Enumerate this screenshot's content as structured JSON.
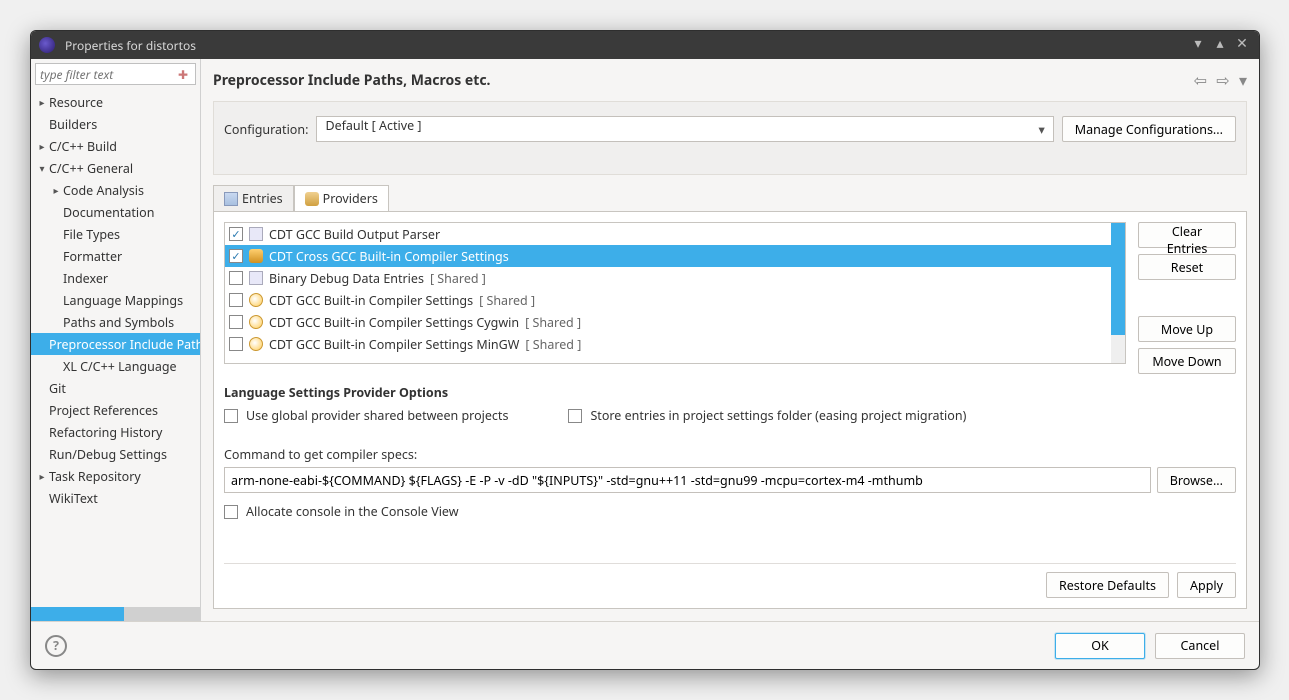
{
  "window": {
    "title": "Properties for distortos"
  },
  "sidebar": {
    "filter_placeholder": "type filter text",
    "items": [
      {
        "label": "Resource",
        "depth": 0,
        "expander": "▸"
      },
      {
        "label": "Builders",
        "depth": 0,
        "expander": ""
      },
      {
        "label": "C/C++ Build",
        "depth": 0,
        "expander": "▸"
      },
      {
        "label": "C/C++ General",
        "depth": 0,
        "expander": "▾"
      },
      {
        "label": "Code Analysis",
        "depth": 1,
        "expander": "▸"
      },
      {
        "label": "Documentation",
        "depth": 1,
        "expander": ""
      },
      {
        "label": "File Types",
        "depth": 1,
        "expander": ""
      },
      {
        "label": "Formatter",
        "depth": 1,
        "expander": ""
      },
      {
        "label": "Indexer",
        "depth": 1,
        "expander": ""
      },
      {
        "label": "Language Mappings",
        "depth": 1,
        "expander": ""
      },
      {
        "label": "Paths and Symbols",
        "depth": 1,
        "expander": ""
      },
      {
        "label": "Preprocessor Include Paths, Macros etc.",
        "depth": 1,
        "expander": "",
        "selected": true
      },
      {
        "label": "XL C/C++ Language",
        "depth": 1,
        "expander": ""
      },
      {
        "label": "Git",
        "depth": 0,
        "expander": ""
      },
      {
        "label": "Project References",
        "depth": 0,
        "expander": ""
      },
      {
        "label": "Refactoring History",
        "depth": 0,
        "expander": ""
      },
      {
        "label": "Run/Debug Settings",
        "depth": 0,
        "expander": ""
      },
      {
        "label": "Task Repository",
        "depth": 0,
        "expander": "▸"
      },
      {
        "label": "WikiText",
        "depth": 0,
        "expander": ""
      }
    ]
  },
  "heading": "Preprocessor Include Paths, Macros etc.",
  "config": {
    "label": "Configuration:",
    "value": "Default  [ Active ]",
    "manage": "Manage Configurations..."
  },
  "tabs": {
    "entries": "Entries",
    "providers": "Providers"
  },
  "providers": {
    "rows": [
      {
        "checked": true,
        "icon": "doc",
        "label": "CDT GCC Build Output Parser",
        "shared": ""
      },
      {
        "checked": true,
        "icon": "wrench",
        "label": "CDT Cross GCC Built-in Compiler Settings",
        "shared": "",
        "selected": true
      },
      {
        "checked": false,
        "icon": "doc",
        "label": "Binary Debug Data Entries",
        "shared": "[ Shared ]"
      },
      {
        "checked": false,
        "icon": "mag",
        "label": "CDT GCC Built-in Compiler Settings",
        "shared": "[ Shared ]"
      },
      {
        "checked": false,
        "icon": "mag",
        "label": "CDT GCC Built-in Compiler Settings Cygwin",
        "shared": "[ Shared ]"
      },
      {
        "checked": false,
        "icon": "mag",
        "label": "CDT GCC Built-in Compiler Settings MinGW",
        "shared": "[ Shared ]"
      }
    ],
    "buttons": {
      "clear": "Clear Entries",
      "reset": "Reset",
      "moveup": "Move Up",
      "movedown": "Move Down"
    }
  },
  "options": {
    "title": "Language Settings Provider Options",
    "global": "Use global provider shared between projects",
    "store": "Store entries in project settings folder (easing project migration)"
  },
  "command": {
    "label": "Command to get compiler specs:",
    "value": "arm-none-eabi-${COMMAND} ${FLAGS} -E -P -v -dD \"${INPUTS}\" -std=gnu++11 -std=gnu99 -mcpu=cortex-m4 -mthumb",
    "browse": "Browse..."
  },
  "allocate": "Allocate console in the Console View",
  "bottom": {
    "restore": "Restore Defaults",
    "apply": "Apply"
  },
  "footer": {
    "ok": "OK",
    "cancel": "Cancel"
  }
}
